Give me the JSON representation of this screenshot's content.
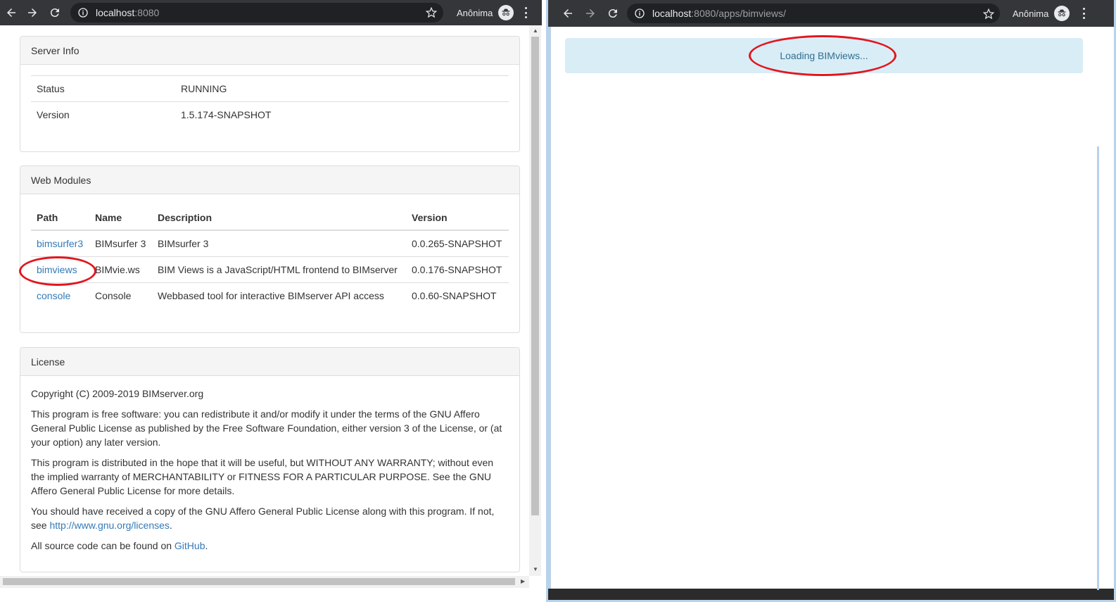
{
  "left_window": {
    "omnibox": {
      "host": "localhost",
      "rest": ":8080"
    },
    "profile_label": "Anônima",
    "server_info": {
      "heading": "Server Info",
      "rows": [
        {
          "key": "Status",
          "value": "RUNNING"
        },
        {
          "key": "Version",
          "value": "1.5.174-SNAPSHOT"
        }
      ]
    },
    "web_modules": {
      "heading": "Web Modules",
      "columns": [
        "Path",
        "Name",
        "Description",
        "Version"
      ],
      "rows": [
        {
          "path": "bimsurfer3",
          "name": "BIMsurfer 3",
          "description": "BIMsurfer 3",
          "version": "0.0.265-SNAPSHOT"
        },
        {
          "path": "bimviews",
          "name": "BIMvie.ws",
          "description": "BIM Views is a JavaScript/HTML frontend to BIMserver",
          "version": "0.0.176-SNAPSHOT"
        },
        {
          "path": "console",
          "name": "Console",
          "description": "Webbased tool for interactive BIMserver API access",
          "version": "0.0.60-SNAPSHOT"
        }
      ]
    },
    "license": {
      "heading": "License",
      "copyright": "Copyright (C) 2009-2019 BIMserver.org",
      "p1": "This program is free software: you can redistribute it and/or modify it under the terms of the GNU Affero General Public License as published by the Free Software Foundation, either version 3 of the License, or (at your option) any later version.",
      "p2": "This program is distributed in the hope that it will be useful, but WITHOUT ANY WARRANTY; without even the implied warranty of MERCHANTABILITY or FITNESS FOR A PARTICULAR PURPOSE. See the GNU Affero General Public License for more details.",
      "p3_text": "You should have received a copy of the GNU Affero General Public License along with this program. If not, see ",
      "p3_link": "http://www.gnu.org/licenses",
      "p3_end": ".",
      "p4_text": "All source code can be found on ",
      "p4_link": "GitHub",
      "p4_end": "."
    }
  },
  "right_window": {
    "omnibox": {
      "host": "localhost",
      "rest": ":8080/apps/bimviews/"
    },
    "profile_label": "Anônima",
    "loading_text": "Loading BIMviews..."
  },
  "colors": {
    "annotation": "#e3151e",
    "link": "#337ab7",
    "alert_bg": "#d9edf7",
    "toolbar": "#35363a"
  }
}
